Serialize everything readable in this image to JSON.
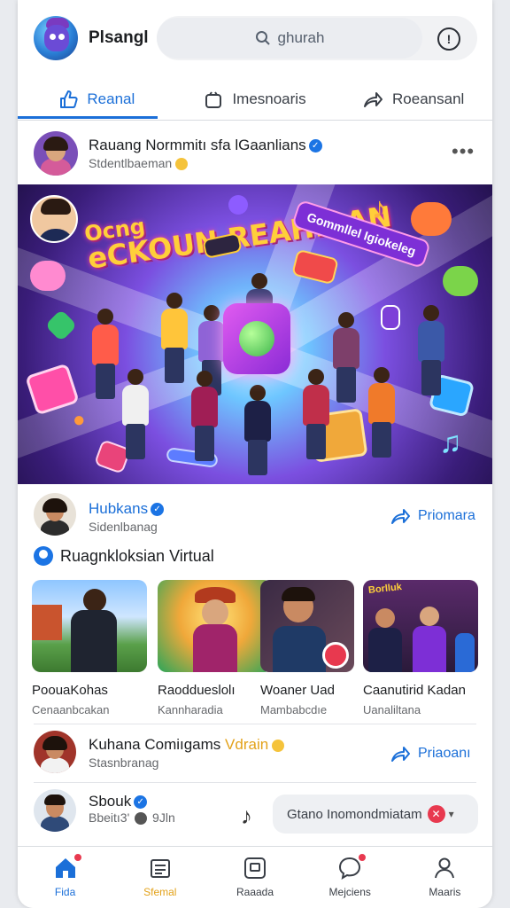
{
  "app": {
    "name": "Plsangl",
    "search_placeholder": "ɡhurah"
  },
  "tabs": [
    {
      "label": "Reanal",
      "icon": "thumbs-up-icon",
      "active": true
    },
    {
      "label": "Imesnoaris",
      "icon": "bag-icon",
      "active": false
    },
    {
      "label": "Roeansanl",
      "icon": "share-icon",
      "active": false
    }
  ],
  "post1": {
    "author": "Rauang Normmitı sfa lGaanlians",
    "subtitle": "Stdentlbaeman",
    "hero": {
      "title_line1": "Ocng",
      "title_line2": "eCKOUN REAHIAAN",
      "banner": "Gommllel Igiokeleg"
    }
  },
  "post2": {
    "author": "Hubkans",
    "subtitle": "Sidenlbanag",
    "share_label": "Priomara"
  },
  "section": {
    "title": "Ruagnkloksian Virtual"
  },
  "cards": [
    {
      "title": "PoouaKohas",
      "subtitle": "Cenaanbcakan"
    },
    {
      "title": "Raoddueslolı",
      "subtitle": "Kannharadia"
    },
    {
      "title": "Woaner Uad",
      "subtitle": "Mambabcdıe"
    },
    {
      "title": "Caanutirid Kadan",
      "subtitle": "Uanaliltana",
      "thumb_text": "Borlluk"
    }
  ],
  "post3": {
    "author": "Kuhana Comiıgams",
    "author_highlight": "Vdrain",
    "subtitle": "Stasnbranag",
    "share_label": "Priaoanı"
  },
  "post4": {
    "author": "Sbouk",
    "subtitle": "Bbeitı3'",
    "subtitle_tail": "9Jln",
    "pill_text": "Gtano Inomondmiatam"
  },
  "bottom_nav": [
    {
      "label": "Fida",
      "icon": "home-icon",
      "active": true,
      "badge": true
    },
    {
      "label": "Sfemal",
      "icon": "list-icon",
      "active": false,
      "badge": false
    },
    {
      "label": "Raaada",
      "icon": "tablet-icon",
      "active": false,
      "badge": false
    },
    {
      "label": "Mejciens",
      "icon": "chat-icon",
      "active": false,
      "badge": true
    },
    {
      "label": "Maaris",
      "icon": "profile-icon",
      "active": false,
      "badge": false
    }
  ],
  "colors": {
    "accent": "#1b6fd8",
    "highlight": "#e3a21a",
    "badge": "#e8394f"
  }
}
